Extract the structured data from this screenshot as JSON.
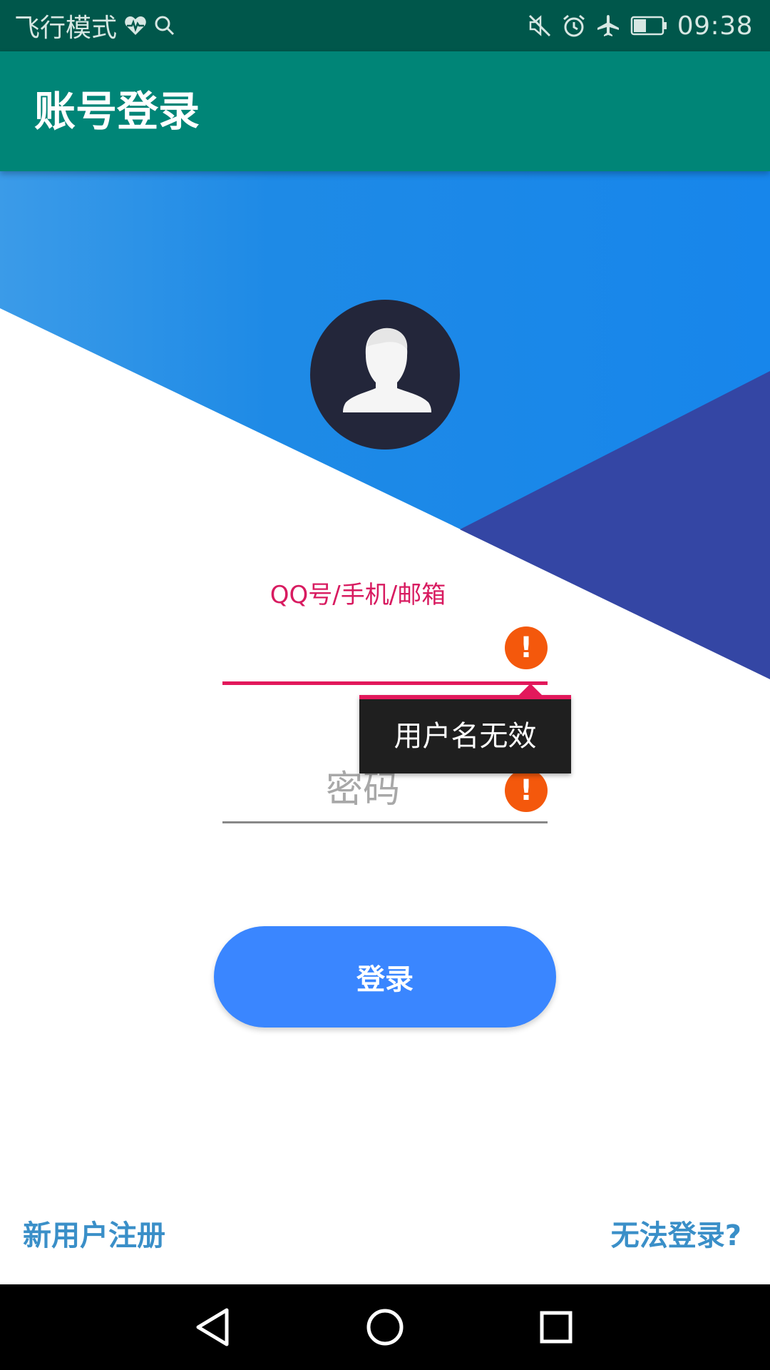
{
  "status_bar": {
    "left_text": "飞行模式",
    "icons_left": [
      "heart-pulse-icon",
      "search-icon"
    ],
    "icons_right": [
      "mute-icon",
      "alarm-icon",
      "airplane-icon",
      "battery-icon"
    ],
    "time": "09:38",
    "battery_level": 0.45,
    "background": "#00574b"
  },
  "app_bar": {
    "title": "账号登录",
    "background": "#008577"
  },
  "form": {
    "username": {
      "label": "QQ号/手机/邮箱",
      "value": "",
      "error_icon": "error-icon",
      "error_icon_glyph": "!",
      "error_message": "用户名无效",
      "accent_color": "#e2185b"
    },
    "password": {
      "placeholder": "密码",
      "error_icon": "error-icon",
      "error_icon_glyph": "!"
    },
    "login_button_label": "登录",
    "button_color": "#3a86ff"
  },
  "links": {
    "register": "新用户注册",
    "forgot": "无法登录?"
  },
  "nav_bar": {
    "icons": [
      "back-icon",
      "home-icon",
      "recents-icon"
    ]
  }
}
